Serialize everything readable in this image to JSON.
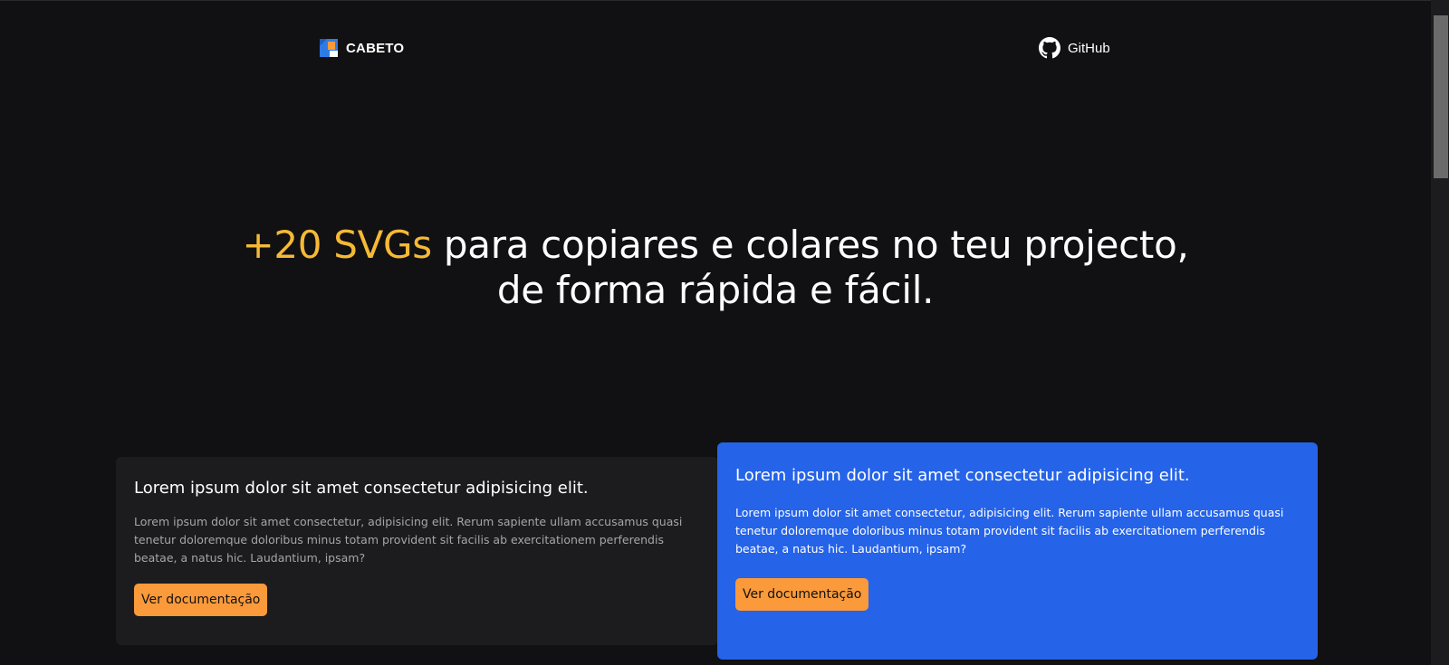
{
  "header": {
    "brand_name": "CABETO",
    "github_label": "GitHub"
  },
  "hero": {
    "highlight": "+20 SVGs",
    "line1_rest": " para copiares e colares no teu projecto,",
    "line2": "de forma rápida e fácil."
  },
  "cards": [
    {
      "title": "Lorem ipsum dolor sit amet consectetur adipisicing elit.",
      "text": "Lorem ipsum dolor sit amet consectetur, adipisicing elit. Rerum sapiente ullam accusamus quasi tenetur doloremque doloribus minus totam provident sit facilis ab exercitationem perferendis beatae, a natus hic. Laudantium, ipsam?",
      "button": "Ver documentação"
    },
    {
      "title": "Lorem ipsum dolor sit amet consectetur adipisicing elit.",
      "text": "Lorem ipsum dolor sit amet consectetur, adipisicing elit. Rerum sapiente ullam accusamus quasi tenetur doloremque doloribus minus totam provident sit facilis ab exercitationem perferendis beatae, a natus hic. Laudantium, ipsam?",
      "button": "Ver documentação"
    }
  ],
  "icons": {
    "brand": "cabeto-logo-icon",
    "github": "github-icon"
  },
  "colors": {
    "background": "#111012",
    "highlight": "#f5b935",
    "accent_card": "#2563e8",
    "button": "#fb9a3b"
  }
}
